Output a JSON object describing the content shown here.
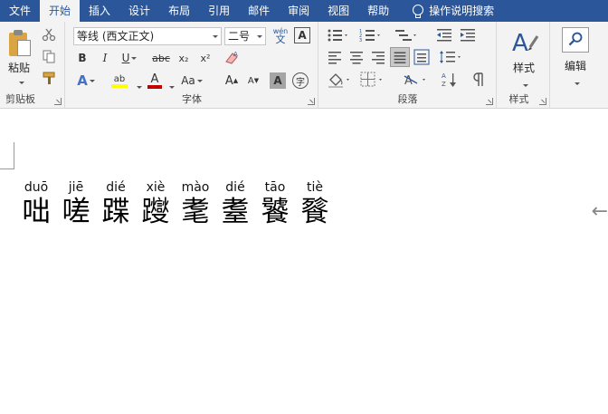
{
  "menu": {
    "tabs": [
      {
        "label": "文件"
      },
      {
        "label": "开始"
      },
      {
        "label": "插入"
      },
      {
        "label": "设计"
      },
      {
        "label": "布局"
      },
      {
        "label": "引用"
      },
      {
        "label": "邮件"
      },
      {
        "label": "审阅"
      },
      {
        "label": "视图"
      },
      {
        "label": "帮助"
      }
    ],
    "active_tab": "开始",
    "tell_me": "操作说明搜索"
  },
  "ribbon": {
    "clipboard": {
      "label": "剪贴板",
      "paste": "粘贴"
    },
    "font": {
      "label": "字体",
      "font_name": "等线 (西文正文)",
      "font_size": "二号",
      "phonetic": "wén",
      "phonetic_char": "文",
      "border_char": "A",
      "bold": "B",
      "italic": "I",
      "underline": "U",
      "strike": "abc",
      "subscript": "x₂",
      "superscript": "x²",
      "font_color": "A",
      "change_case": "Aa",
      "grow": "A",
      "shrink": "A",
      "shading": "A",
      "enclose": "字"
    },
    "paragraph": {
      "label": "段落"
    },
    "styles": {
      "label": "样式",
      "button": "样式"
    },
    "editing": {
      "button": "编辑"
    },
    "colors": {
      "accent": "#2b579a",
      "highlight": "#ffff00",
      "font_red": "#c00000"
    }
  },
  "document": {
    "ruby_text": [
      {
        "py": "duō",
        "hz": "咄"
      },
      {
        "py": "jiē",
        "hz": "嗟"
      },
      {
        "py": "dié",
        "hz": "蹀"
      },
      {
        "py": "xiè",
        "hz": "躞"
      },
      {
        "py": "mào",
        "hz": "耄"
      },
      {
        "py": "dié",
        "hz": "耋"
      },
      {
        "py": "tāo",
        "hz": "饕"
      },
      {
        "py": "tiè",
        "hz": "餮"
      }
    ]
  }
}
